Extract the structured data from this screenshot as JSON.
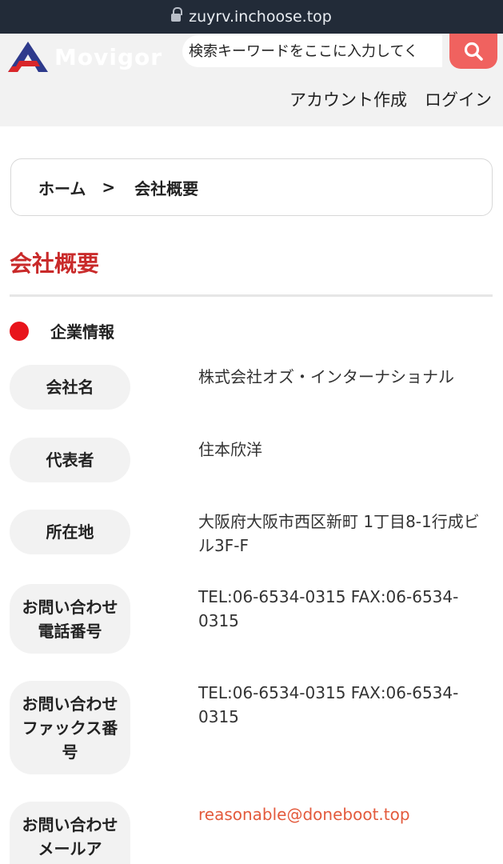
{
  "browser": {
    "url": "zuyrv.inchoose.top"
  },
  "header": {
    "logo_text": "Movigor",
    "search_placeholder": "検索キーワードをここに入力してく",
    "account_link": "アカウント作成",
    "login_link": "ログイン"
  },
  "breadcrumb": {
    "home": "ホーム",
    "separator": ">",
    "current": "会社概要"
  },
  "page": {
    "title": "会社概要",
    "section": "企業情報"
  },
  "rows": [
    {
      "label": "会社名",
      "value": "株式会社オズ・インターナショナル"
    },
    {
      "label": "代表者",
      "value": "住本欣洋"
    },
    {
      "label": "所在地",
      "value": "大阪府大阪市西区新町 1丁目8-1行成ビル3F-F"
    },
    {
      "label": "お問い合わせ電話番号",
      "value": "TEL:06-6534-0315 FAX:06-6534-0315"
    },
    {
      "label": "お問い合わせファックス番号",
      "value": "TEL:06-6534-0315 FAX:06-6534-0315"
    },
    {
      "label": "お問い合わせメールア",
      "value": "reasonable@doneboot.top"
    }
  ],
  "colors": {
    "accent": "#c92a2a",
    "search_button": "#f0625f",
    "email_link": "#e35a3c"
  }
}
